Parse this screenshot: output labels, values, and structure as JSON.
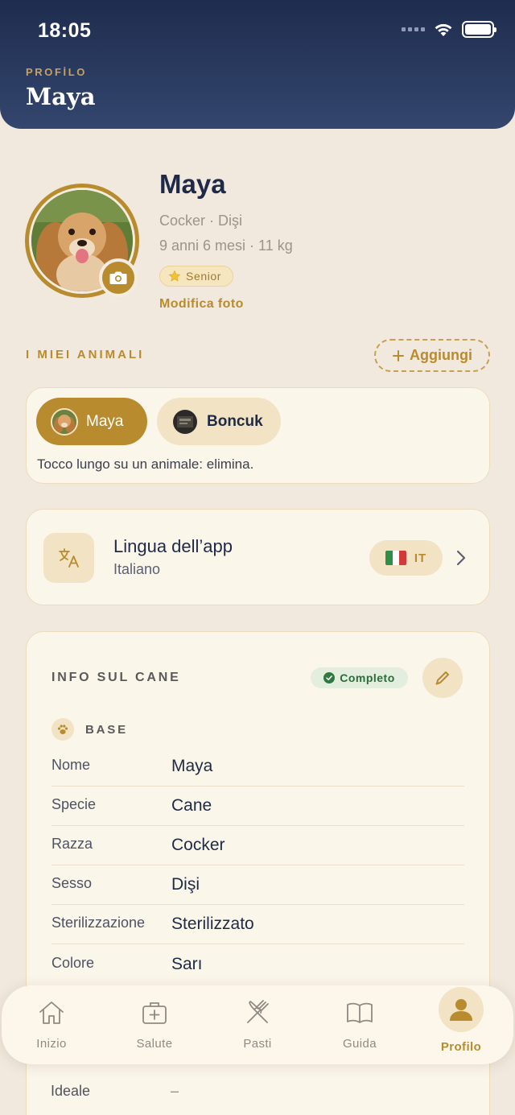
{
  "status_bar": {
    "time": "18:05"
  },
  "header": {
    "kicker": "PROFİLO",
    "title": "Maya"
  },
  "profile": {
    "name": "Maya",
    "breed_sex": "Cocker · Dişi",
    "age_weight": "9 anni 6 mesi · 11 kg",
    "badge": "Senior",
    "edit_photo": "Modifica foto"
  },
  "my_pets": {
    "label": "I MIEI ANIMALI",
    "add_label": "Aggiungi",
    "pets": [
      {
        "name": "Maya",
        "active": true
      },
      {
        "name": "Boncuk",
        "active": false
      }
    ],
    "hint": "Tocco lungo su un animale: elimina."
  },
  "language": {
    "title": "Lingua dell’app",
    "subtitle": "Italiano",
    "code": "IT",
    "flag_colors": [
      "#2f8f46",
      "#ffffff",
      "#d23a3a"
    ]
  },
  "dog_info": {
    "title": "INFO SUL CANE",
    "status": "Completo",
    "section": "BASE",
    "rows": [
      {
        "key": "Nome",
        "value": "Maya"
      },
      {
        "key": "Specie",
        "value": "Cane"
      },
      {
        "key": "Razza",
        "value": "Cocker"
      },
      {
        "key": "Sesso",
        "value": "Dişi"
      },
      {
        "key": "Sterilizzazione",
        "value": "Sterilizzato"
      },
      {
        "key": "Colore",
        "value": "Sarı"
      }
    ],
    "partial_row": {
      "key": "Ideale",
      "value": "–"
    }
  },
  "tabbar": {
    "tabs": [
      {
        "label": "Inizio",
        "icon": "home-icon"
      },
      {
        "label": "Salute",
        "icon": "medical-kit-icon"
      },
      {
        "label": "Pasti",
        "icon": "fork-knife-icon"
      },
      {
        "label": "Guida",
        "icon": "book-icon"
      },
      {
        "label": "Profilo",
        "icon": "person-icon",
        "active": true
      }
    ]
  },
  "colors": {
    "header_navy": "#1e2c4e",
    "accent_gold": "#b88b2e",
    "background": "#f1e9dd",
    "card": "#fbf6ea",
    "success_green": "#2c7a3e"
  }
}
